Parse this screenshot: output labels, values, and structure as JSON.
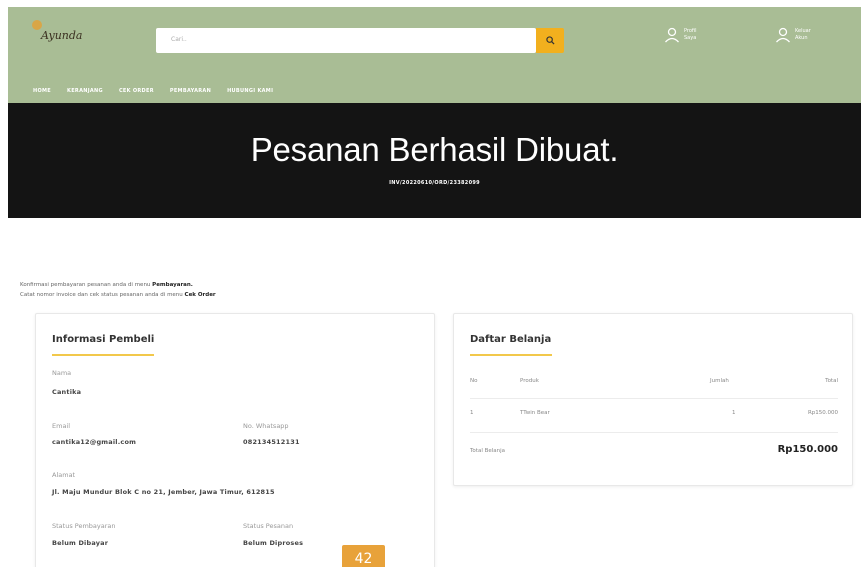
{
  "header": {
    "logo_text": "Ayunda",
    "search_placeholder": "Cari..",
    "profile": {
      "line1": "Profil",
      "line2": "Saya"
    },
    "logout": {
      "line1": "Keluar",
      "line2": "Akun"
    },
    "nav": [
      "HOME",
      "KERANJANG",
      "CEK ORDER",
      "PEMBAYARAN",
      "HUBUNGI KAMI"
    ]
  },
  "hero": {
    "title": "Pesanan Berhasil Dibuat.",
    "invoice": "INV/20220610/ORD/23382099"
  },
  "message": {
    "line1_prefix": "Konfirmasi pembayaran pesanan anda di menu ",
    "line1_link": "Pembayaran.",
    "line2_prefix": "Catat nomor invoice dan cek status pesanan anda di menu ",
    "line2_link": "Cek Order"
  },
  "buyer": {
    "title": "Informasi Pembeli",
    "name_label": "Nama",
    "name": "Cantika",
    "email_label": "Email",
    "email": "cantika12@gmail.com",
    "wa_label": "No. Whatsapp",
    "wa": "082134512131",
    "address_label": "Alamat",
    "address": "Jl. Maju Mundur Blok C no 21, Jember, Jawa Timur, 612815",
    "payment_status_label": "Status Pembayaran",
    "payment_status": "Belum Dibayar",
    "order_status_label": "Status Pesanan",
    "order_status": "Belum Diproses"
  },
  "cart": {
    "title": "Daftar Belanja",
    "headers": {
      "no": "No",
      "product": "Produk",
      "qty": "Jumlah",
      "total": "Total"
    },
    "rows": [
      {
        "no": "1",
        "product": "TTwin Bear",
        "qty": "1",
        "total": "Rp150.000"
      }
    ],
    "total_label": "Total Belanja",
    "total_value": "Rp150.000"
  },
  "page_number": "42",
  "colors": {
    "header": "#a9bd95",
    "hero": "#141414",
    "accent": "#f2b01e"
  }
}
